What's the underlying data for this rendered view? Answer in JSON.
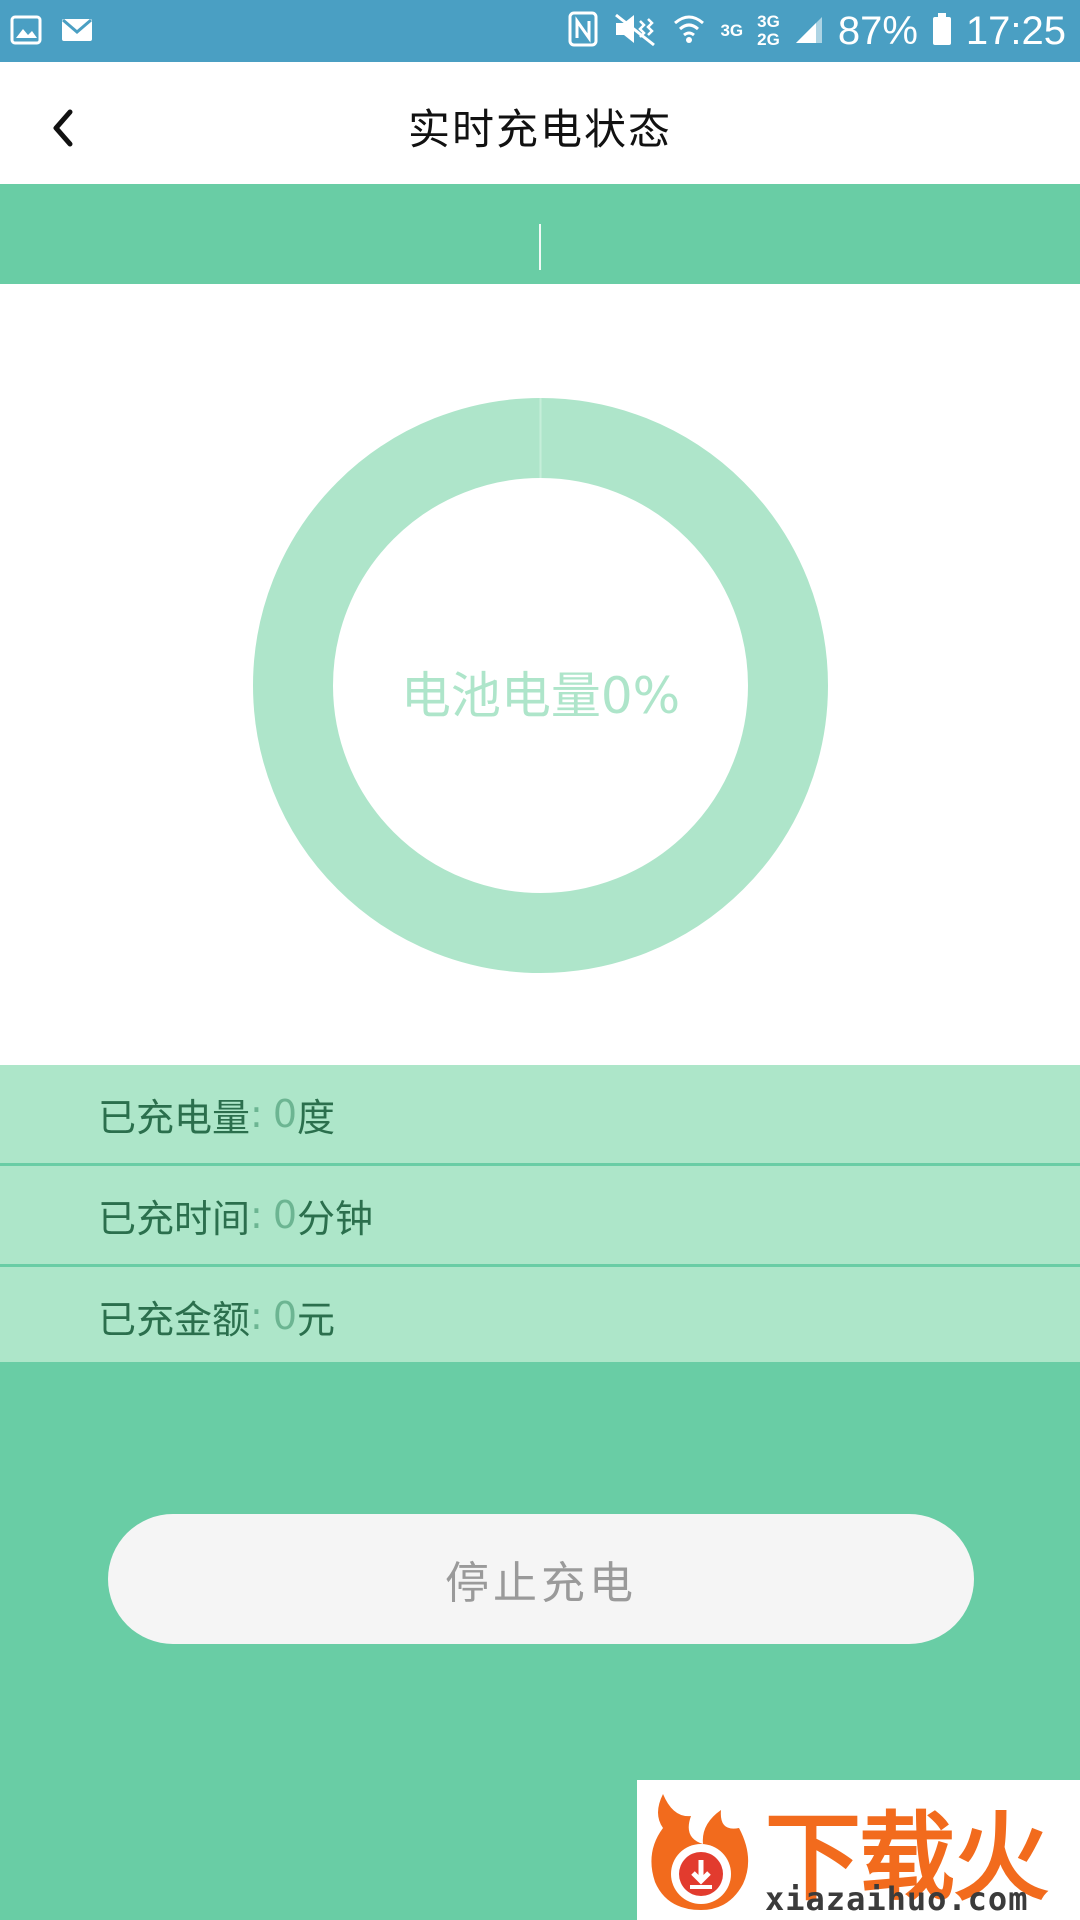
{
  "status_bar": {
    "battery_percent": "87%",
    "time": "17:25",
    "net_top": "3G",
    "net_mid_top": "3G",
    "net_mid_bottom": "2G"
  },
  "header": {
    "title": "实时充电状态"
  },
  "gauge": {
    "label": "电池电量0%",
    "percent": 0,
    "ring_color": "#aee5ca"
  },
  "info": [
    {
      "label": "已充电量",
      "colon": ":",
      "value": "0",
      "unit": "度"
    },
    {
      "label": "已充时间",
      "colon": ":",
      "value": "0",
      "unit": "分钟"
    },
    {
      "label": "已充金额",
      "colon": ":",
      "value": "0",
      "unit": "元"
    }
  ],
  "actions": {
    "stop_label": "停止充电"
  },
  "watermark": {
    "brand": "下载火",
    "url": "xiazaihuo.com"
  },
  "colors": {
    "primary_green": "#69cda5",
    "light_green": "#ade6c9",
    "status_bar": "#4a9fc3"
  }
}
